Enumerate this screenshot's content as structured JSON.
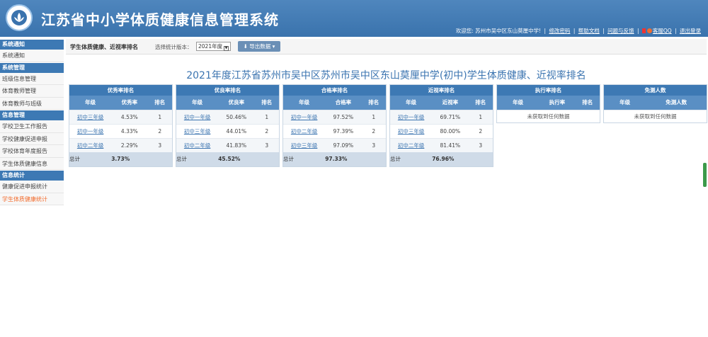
{
  "header": {
    "app_title": "江苏省中小学体质健康信息管理系统",
    "welcome": "欢迎您: 苏州市吴中区东山莫厘中学!",
    "links": [
      "修改密码",
      "帮助文档",
      "问题与反馈"
    ],
    "qq": "客服QQ",
    "logout": "退出登录"
  },
  "sidebar": {
    "sections": [
      {
        "title": "系统通知",
        "items": [
          "系统通知"
        ]
      },
      {
        "title": "系统管理",
        "items": [
          "班级信息管理",
          "体育教师管理",
          "体育教师与班级"
        ]
      },
      {
        "title": "信息管理",
        "items": [
          "学校卫生工作报告",
          "学校健康促进申报",
          "学校体育年度报告",
          "学生体质健康信息"
        ]
      },
      {
        "title": "信息统计",
        "items": [
          "健康促进申报统计",
          "学生体质健康统计"
        ]
      }
    ]
  },
  "toolbar": {
    "title": "学生体质健康、近视率排名",
    "version_label": "选择统计版本：",
    "version_value": "2021年度",
    "export_label": "导出数据"
  },
  "page_title": "2021年度江苏省苏州市吴中区苏州市吴中区东山莫厘中学(初中)学生体质健康、近视率排名",
  "tables": [
    {
      "title": "优秀率排名",
      "cols": [
        "年级",
        "优秀率",
        "排名"
      ],
      "rows": [
        [
          "初中三年级",
          "4.53%",
          "1"
        ],
        [
          "初中一年级",
          "4.33%",
          "2"
        ],
        [
          "初中二年级",
          "2.29%",
          "3"
        ]
      ],
      "total": [
        "总计",
        "3.73%",
        ""
      ]
    },
    {
      "title": "优良率排名",
      "cols": [
        "年级",
        "优良率",
        "排名"
      ],
      "rows": [
        [
          "初中一年级",
          "50.46%",
          "1"
        ],
        [
          "初中三年级",
          "44.01%",
          "2"
        ],
        [
          "初中二年级",
          "41.83%",
          "3"
        ]
      ],
      "total": [
        "总计",
        "45.52%",
        ""
      ]
    },
    {
      "title": "合格率排名",
      "cols": [
        "年级",
        "合格率",
        "排名"
      ],
      "rows": [
        [
          "初中一年级",
          "97.52%",
          "1"
        ],
        [
          "初中二年级",
          "97.39%",
          "2"
        ],
        [
          "初中三年级",
          "97.09%",
          "3"
        ]
      ],
      "total": [
        "总计",
        "97.33%",
        ""
      ]
    },
    {
      "title": "近视率排名",
      "cols": [
        "年级",
        "近视率",
        "排名"
      ],
      "rows": [
        [
          "初中一年级",
          "69.71%",
          "1"
        ],
        [
          "初中三年级",
          "80.00%",
          "2"
        ],
        [
          "初中二年级",
          "81.41%",
          "3"
        ]
      ],
      "total": [
        "总计",
        "76.96%",
        ""
      ]
    },
    {
      "title": "执行率排名",
      "cols": [
        "年级",
        "执行率",
        "排名"
      ],
      "empty": "未获取到任何数据"
    },
    {
      "title": "免测人数",
      "cols": [
        "年级",
        "免测人数"
      ],
      "empty": "未获取到任何数据"
    }
  ]
}
